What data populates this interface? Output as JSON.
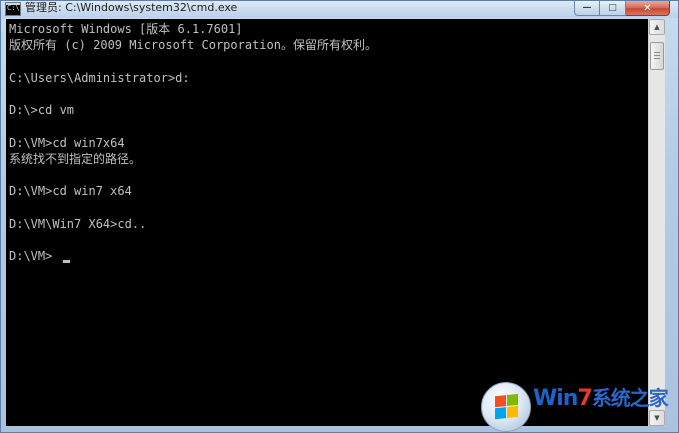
{
  "window": {
    "title": "管理员: C:\\Windows\\system32\\cmd.exe",
    "icon_text": "C:\\",
    "controls": {
      "minimize": "—",
      "maximize": "□",
      "close": "✕"
    }
  },
  "console": {
    "lines": [
      "Microsoft Windows [版本 6.1.7601]",
      "版权所有 (c) 2009 Microsoft Corporation。保留所有权利。",
      "",
      "C:\\Users\\Administrator>d:",
      "",
      "D:\\>cd vm",
      "",
      "D:\\VM>cd win7x64",
      "系统找不到指定的路径。",
      "",
      "D:\\VM>cd win7 x64",
      "",
      "D:\\VM\\Win7 X64>cd..",
      "",
      "D:\\VM>"
    ],
    "text_color": "#c0c0c0",
    "background_color": "#000000"
  },
  "scrollbar": {
    "up_arrow": "▲",
    "down_arrow": "▼"
  },
  "watermark": {
    "brand_prefix": "Win",
    "brand_seven": "7",
    "brand_cn": "系统之家",
    "flag_colors": [
      "#f25022",
      "#7fba00",
      "#00a4ef",
      "#ffb900"
    ]
  }
}
